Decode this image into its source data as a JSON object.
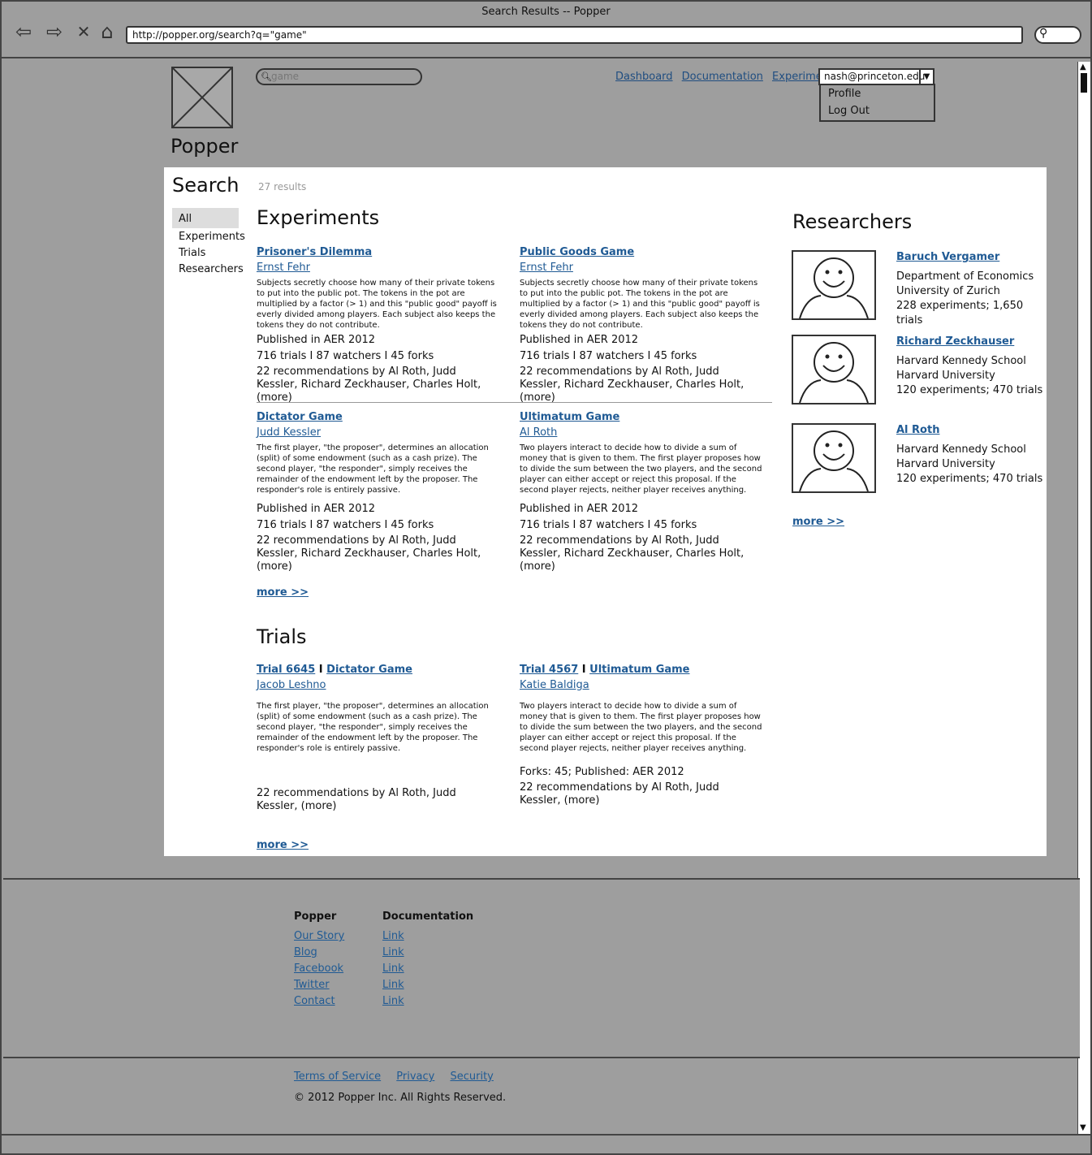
{
  "window": {
    "title": "Search Results -- Popper"
  },
  "browser": {
    "url": "http://popper.org/search?q=\"game\""
  },
  "site": {
    "name": "Popper"
  },
  "search": {
    "value": "game"
  },
  "topnav": [
    "Dashboard",
    "Documentation",
    "Experiments"
  ],
  "user": {
    "email": "nash@princeton.edu",
    "menu": [
      "Profile",
      "Log Out"
    ]
  },
  "page": {
    "title": "Search",
    "result_count": "27 results"
  },
  "filters": [
    "All",
    "Experiments",
    "Trials",
    "Researchers"
  ],
  "experiments": {
    "heading": "Experiments",
    "more": "more >>",
    "items": [
      {
        "title": "Prisoner's Dilemma",
        "author": "Ernst Fehr",
        "description": "Subjects secretly choose how many of their private tokens to put into the public pot. The tokens in the pot are multiplied by a factor (> 1) and this \"public good\" payoff is everly divided among players. Each subject also keeps the tokens they do not contribute.",
        "published": "Published in AER 2012",
        "stats": "716 trials I 87 watchers I 45 forks",
        "recommendations": "22 recommendations by Al Roth, Judd Kessler, Richard Zeckhauser, Charles Holt, (more)"
      },
      {
        "title": "Public Goods Game",
        "author": "Ernst Fehr",
        "description": "Subjects secretly choose how many of their private tokens to put into the public pot. The tokens in the pot are multiplied by a factor (> 1) and this \"public good\" payoff is everly divided among players. Each subject also keeps the tokens they do not contribute.",
        "published": "Published in AER 2012",
        "stats": "716 trials I 87 watchers I 45 forks",
        "recommendations": "22 recommendations by Al Roth, Judd Kessler, Richard Zeckhauser, Charles Holt, (more)"
      },
      {
        "title": "Dictator Game",
        "author": "Judd Kessler",
        "description": "The first player, \"the proposer\", determines an allocation (split) of some endowment (such as a cash prize). The second player, \"the responder\", simply receives the remainder of the endowment left by the proposer. The responder's role is entirely passive.",
        "published": "Published in AER 2012",
        "stats": "716 trials I 87 watchers I 45 forks",
        "recommendations": "22 recommendations by Al Roth, Judd Kessler, Richard Zeckhauser, Charles Holt, (more)"
      },
      {
        "title": "Ultimatum Game",
        "author": "Al Roth",
        "description": "Two players interact to decide how to divide a sum of money that is given to them. The first player proposes how to divide the sum between the two players, and the second player can either accept or reject this proposal. If the second player rejects, neither player receives anything.",
        "published": "Published in AER 2012",
        "stats": "716 trials I 87 watchers I 45 forks",
        "recommendations": "22 recommendations by Al Roth, Judd Kessler, Richard Zeckhauser, Charles Holt, (more)"
      }
    ]
  },
  "trials": {
    "heading": "Trials",
    "more": "more >>",
    "items": [
      {
        "trial": "Trial 6645",
        "separator": "I",
        "experiment": "Dictator Game",
        "author": "Jacob Leshno",
        "description": "The first player, \"the proposer\", determines an allocation (split) of some endowment (such as a cash prize). The second player, \"the responder\", simply receives the remainder of the endowment left by the proposer. The responder's role is entirely passive.",
        "extra": "",
        "recommendations": "22 recommendations by Al Roth, Judd Kessler, (more)"
      },
      {
        "trial": "Trial 4567",
        "separator": "I",
        "experiment": "Ultimatum Game",
        "author": "Katie Baldiga",
        "description": "Two players interact to decide how to divide a sum of money that is given to them. The first player proposes how to divide the sum between the two players, and the second player can either accept or reject this proposal. If the second player rejects, neither player receives anything.",
        "extra": "Forks: 45; Published: AER 2012",
        "recommendations": "22 recommendations by Al Roth, Judd Kessler, (more)"
      }
    ]
  },
  "researchers": {
    "heading": "Researchers",
    "more": "more >>",
    "items": [
      {
        "name": "Baruch Vergamer",
        "line1": "Department of Economics",
        "line2": "University of Zurich",
        "stats": "228 experiments; 1,650 trials"
      },
      {
        "name": "Richard Zeckhauser",
        "line1": "Harvard Kennedy School",
        "line2": "Harvard University",
        "stats": "120 experiments; 470 trials"
      },
      {
        "name": "Al Roth",
        "line1": "Harvard Kennedy School",
        "line2": "Harvard University",
        "stats": "120 experiments; 470 trials"
      }
    ]
  },
  "footer": {
    "col1": {
      "heading": "Popper",
      "links": [
        "Our Story",
        "Blog",
        "Facebook",
        "Twitter",
        "Contact"
      ]
    },
    "col2": {
      "heading": "Documentation",
      "links": [
        "Link",
        "Link",
        "Link",
        "Link",
        "Link"
      ]
    },
    "legal": [
      "Terms of Service",
      "Privacy",
      "Security"
    ],
    "copyright": "© 2012 Popper Inc. All Rights Reserved."
  }
}
